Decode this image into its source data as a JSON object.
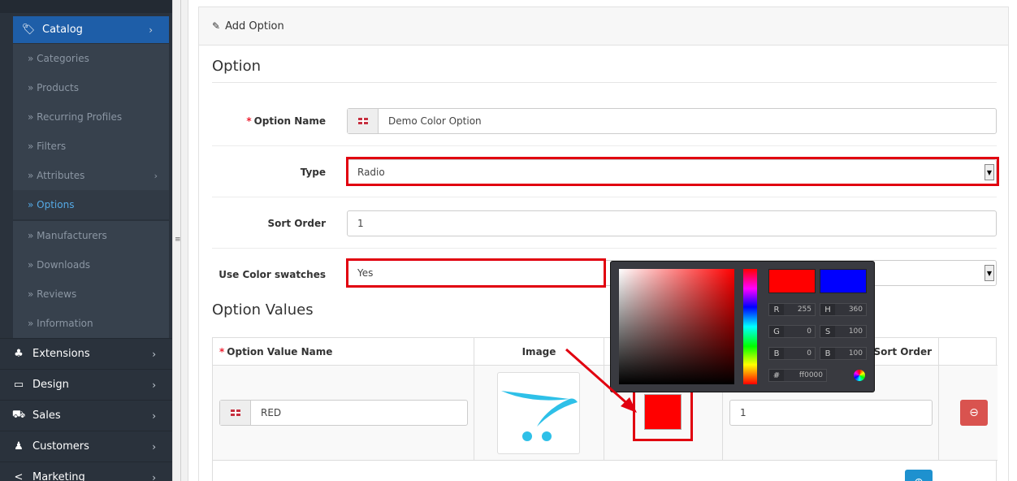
{
  "sidebar": {
    "catalog": {
      "label": "Catalog",
      "icon": "tags-icon"
    },
    "sub_items": [
      {
        "label": "» Categories"
      },
      {
        "label": "» Products"
      },
      {
        "label": "» Recurring Profiles"
      },
      {
        "label": "» Filters"
      },
      {
        "label": "» Attributes"
      },
      {
        "label": "» Options"
      },
      {
        "label": "» Manufacturers"
      },
      {
        "label": "» Downloads"
      },
      {
        "label": "» Reviews"
      },
      {
        "label": "» Information"
      }
    ],
    "items": [
      {
        "label": "Extensions",
        "icon": "puzzle-icon"
      },
      {
        "label": "Design",
        "icon": "monitor-icon"
      },
      {
        "label": "Sales",
        "icon": "cart-icon"
      },
      {
        "label": "Customers",
        "icon": "user-icon"
      },
      {
        "label": "Marketing",
        "icon": "share-icon"
      }
    ]
  },
  "panel": {
    "heading": "Add Option",
    "legend": "Option",
    "option_name": {
      "label": "Option Name",
      "value": "Demo Color Option"
    },
    "type": {
      "label": "Type",
      "value": "Radio"
    },
    "sort_order": {
      "label": "Sort Order",
      "value": "1"
    },
    "color_swatches": {
      "label": "Use Color swatches",
      "value": "Yes"
    }
  },
  "option_values": {
    "title": "Option Values",
    "headers": {
      "name": "Option Value Name",
      "image": "Image",
      "sort": "Sort Order"
    },
    "row": {
      "name": "RED",
      "sort_order": "1",
      "swatch_color": "#ff0000"
    }
  },
  "color_picker": {
    "new_color": "#ff0000",
    "current_color": "#0000ff",
    "r": "255",
    "g": "0",
    "b": "0",
    "h": "360",
    "s": "100",
    "bright": "100",
    "hex": "ff0000",
    "labels": {
      "r": "R",
      "g": "G",
      "b": "B",
      "h": "H",
      "s": "S",
      "bright": "B",
      "hex": "#"
    }
  },
  "colors": {
    "highlight": "#e1000f",
    "sidebar_bg": "#2a323c",
    "catalog_bg": "#1e5ea8"
  }
}
